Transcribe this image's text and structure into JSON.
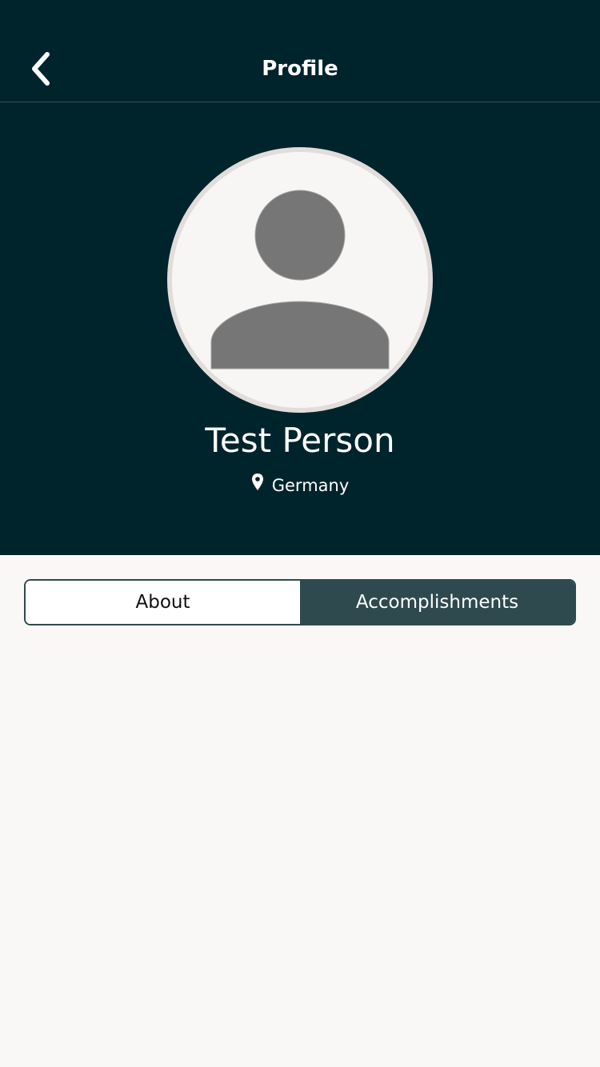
{
  "nav": {
    "title": "Profile",
    "back_icon": "chevron-left-icon"
  },
  "profile": {
    "avatar_icon": "person-placeholder-icon",
    "name": "Test Person",
    "location": "Germany",
    "location_icon": "map-pin-icon"
  },
  "tabs": [
    {
      "label": "About",
      "selected": false
    },
    {
      "label": "Accomplishments",
      "selected": true
    }
  ],
  "colors": {
    "header_background": "#00242c",
    "page_background": "#faf8f6",
    "active_tab": "#2f4a4f",
    "avatar_fill": "#767676",
    "avatar_ring": "#e2dddb"
  }
}
